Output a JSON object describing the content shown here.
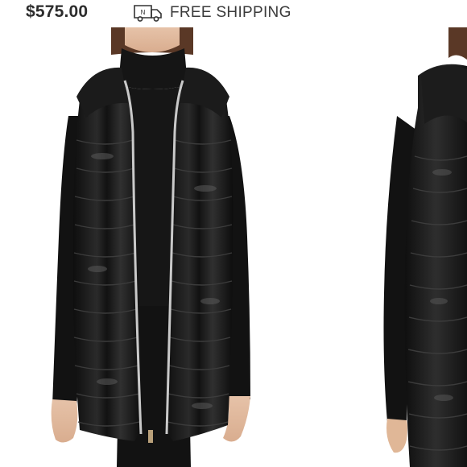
{
  "listing": {
    "price": "$575.00",
    "shipping_label": "FREE SHIPPING",
    "shipping_icon": "delivery-truck-icon",
    "shipping_icon_letter": "N"
  },
  "gallery": {
    "images": [
      {
        "name": "product-photo-front",
        "subject": "black hooded quilted puffer vest worn over black turtleneck"
      },
      {
        "name": "product-photo-side",
        "subject": "same vest, side view with hood up"
      }
    ]
  },
  "colors": {
    "text": "#2d2d2d",
    "vest": "#141414",
    "zipper": "#c9c9c9",
    "skin": "#e9c9b2"
  }
}
